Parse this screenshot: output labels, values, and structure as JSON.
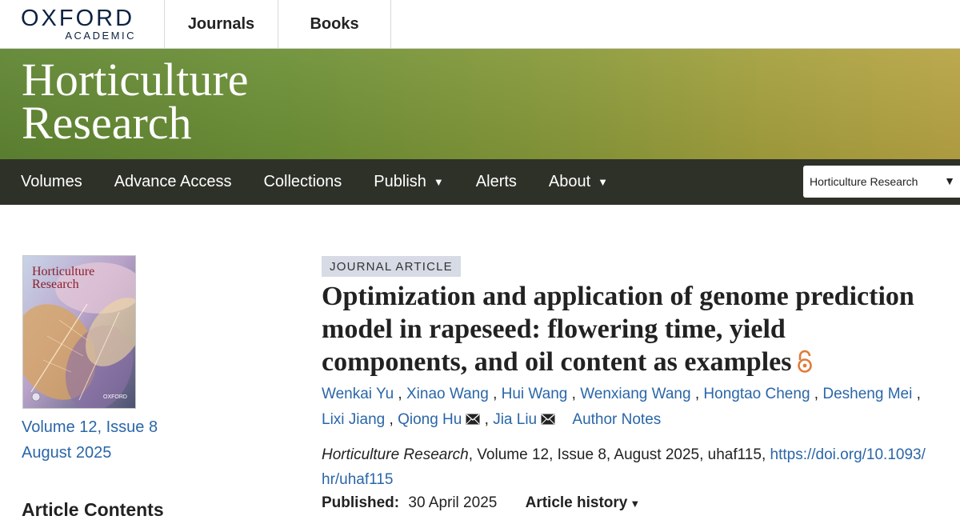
{
  "topbar": {
    "logo_word": "OXFORD",
    "logo_sub": "ACADEMIC",
    "nav": [
      "Journals",
      "Books"
    ]
  },
  "banner": {
    "title_line1": "Horticulture",
    "title_line2": "Research"
  },
  "mainnav": {
    "items": [
      "Volumes",
      "Advance Access",
      "Collections",
      "Publish",
      "Alerts",
      "About"
    ],
    "caret": "▼",
    "select_value": "Horticulture Research",
    "select_caret": "▼"
  },
  "sidebar": {
    "cover_title_line1": "Horticulture",
    "cover_title_line2": "Research",
    "cover_brand": "OXFORD",
    "volume_issue": "Volume 12, Issue 8",
    "issue_date": "August 2025",
    "contents_heading": "Article Contents"
  },
  "article": {
    "type_badge": "JOURNAL ARTICLE",
    "title_line1": "Optimization and application of genome prediction",
    "title_line2": "model in rapeseed: flowering time, yield",
    "title_line3": "components, and oil content as examples",
    "authors": [
      "Wenkai Yu",
      "Xinao Wang",
      "Hui Wang",
      "Wenxiang Wang",
      "Hongtao Cheng",
      "Desheng Mei",
      "Lixi Jiang",
      "Qiong Hu",
      "Jia Liu"
    ],
    "separator": ",",
    "author_notes": "Author Notes",
    "citation_journal": "Horticulture Research",
    "citation_details": ", Volume 12, Issue 8, August 2025, uhaf115,",
    "doi_line1": "https://doi.org/10.1093/",
    "doi_line2": "hr/uhaf115",
    "published_label": "Published:",
    "published_date": "30 April 2025",
    "history_label": "Article history",
    "history_caret": "▼"
  },
  "colors": {
    "link": "#2a66a8",
    "nav_bg": "#2e3128",
    "banner_start": "#5f8532",
    "banner_end": "#b8a444",
    "open_access": "#e07b39",
    "badge_bg": "#d6dbe6"
  },
  "icons": {
    "open_access": "open-access-lock-icon",
    "email": "envelope-icon",
    "dropdown": "caret-down-icon"
  }
}
